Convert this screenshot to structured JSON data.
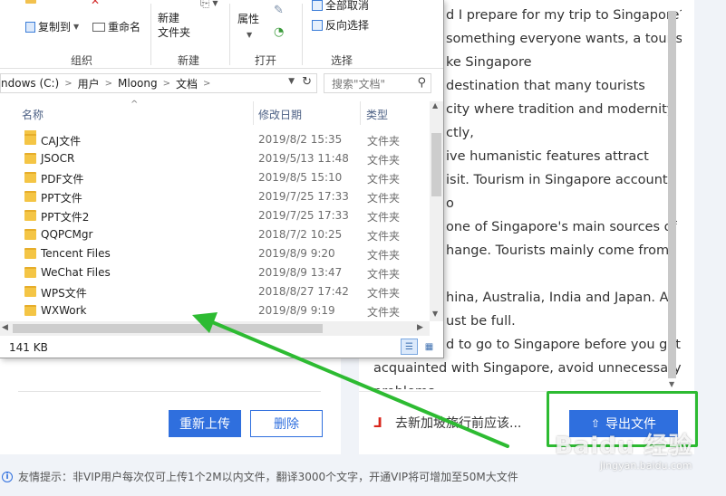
{
  "explorer": {
    "ribbon": {
      "copy_to": "复制到",
      "rename": "重命名",
      "new_folder": "新建\n文件夹",
      "new_folder_l1": "新建",
      "new_folder_l2": "文件夹",
      "properties": "属性",
      "select_none": "全部取消",
      "invert_selection": "反向选择",
      "group_organize": "组织",
      "group_new": "新建",
      "group_open": "打开",
      "group_select": "选择"
    },
    "address": {
      "segments": [
        "ndows (C:)",
        "用户",
        "Mloong",
        "文档"
      ],
      "seg0": "ndows (C:)",
      "seg1": "用户",
      "seg2": "Mloong",
      "seg3": "文档"
    },
    "search": {
      "placeholder": "搜索\"文档\""
    },
    "columns": {
      "name": "名称",
      "date": "修改日期",
      "type": "类型"
    },
    "files": [
      {
        "name": "CAJ文件",
        "date": "2019/8/2 15:35",
        "type": "文件夹"
      },
      {
        "name": "JSOCR",
        "date": "2019/5/13 11:48",
        "type": "文件夹"
      },
      {
        "name": "PDF文件",
        "date": "2019/8/5 15:10",
        "type": "文件夹"
      },
      {
        "name": "PPT文件",
        "date": "2019/7/25 17:33",
        "type": "文件夹"
      },
      {
        "name": "PPT文件2",
        "date": "2019/7/25 17:33",
        "type": "文件夹"
      },
      {
        "name": "QQPCMgr",
        "date": "2018/7/2 10:25",
        "type": "文件夹"
      },
      {
        "name": "Tencent Files",
        "date": "2019/8/9 9:20",
        "type": "文件夹"
      },
      {
        "name": "WeChat Files",
        "date": "2019/8/9 13:47",
        "type": "文件夹"
      },
      {
        "name": "WPS文件",
        "date": "2018/8/27 17:42",
        "type": "文件夹"
      },
      {
        "name": "WXWork",
        "date": "2019/8/9 9:19",
        "type": "文件夹"
      }
    ],
    "status_size": "141 KB"
  },
  "preview": {
    "lines": [
      "d I prepare for my trip to Singapore?",
      "something everyone wants, a tourist",
      "ke Singapore",
      "destination that many tourists",
      "city where tradition and modernity",
      "ctly,",
      "ive humanistic features attract",
      "isit. Tourism in Singapore accounts",
      "o",
      "one of Singapore's main sources of",
      "hange. Tourists mainly come from",
      "",
      "hina, Australia, India and Japan. A",
      "ust be full.",
      "d to go to Singapore before you get",
      "acquainted with Singapore, avoid unnecessary",
      "problems."
    ]
  },
  "upload_panel": {
    "reupload_label": "重新上传",
    "delete_label": "删除"
  },
  "result_panel": {
    "file_name": "去新加坡旅行前应该...",
    "export_label": "导出文件"
  },
  "footer": {
    "tip": "友情提示：非VIP用户每次仅可上传1个2M以内文件，翻译3000个文字，开通VIP将可增加至50M大文件"
  },
  "watermark": {
    "text": "Baidu 经验",
    "sub": "jingyan.baidu.com"
  },
  "colors": {
    "accent": "#2f6fde",
    "highlight": "#2dbb32",
    "folder": "#f4c545"
  }
}
